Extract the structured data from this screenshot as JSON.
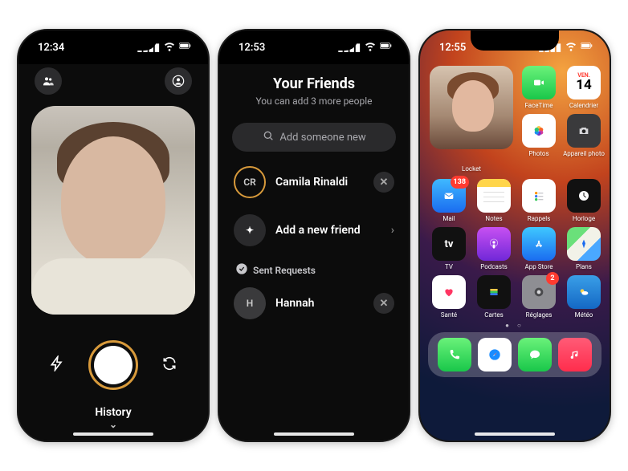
{
  "statusbar": {
    "time1": "12:34",
    "time2": "12:53",
    "time3": "12:55"
  },
  "screen1": {
    "history_label": "History"
  },
  "screen2": {
    "title": "Your Friends",
    "subtitle": "You can add 3 more people",
    "search_placeholder": "Add someone new",
    "friends": [
      {
        "initials": "CR",
        "name": "Camila Rinaldi"
      }
    ],
    "add_friend_label": "Add a new friend",
    "sent_requests_label": "Sent Requests",
    "pending": [
      {
        "initials": "H",
        "name": "Hannah"
      }
    ]
  },
  "screen3": {
    "widget_label": "Locket",
    "cal_weekday": "VEN.",
    "cal_daynum": "14",
    "apps_row1": [
      {
        "label": "FaceTime"
      },
      {
        "label": "Calendrier"
      }
    ],
    "apps_row2": [
      {
        "label": "Photos"
      },
      {
        "label": "Appareil photo"
      }
    ],
    "apps_row3": [
      {
        "label": "Mail",
        "badge": "138"
      },
      {
        "label": "Notes"
      },
      {
        "label": "Rappels"
      },
      {
        "label": "Horloge"
      }
    ],
    "apps_row4": [
      {
        "label": "TV"
      },
      {
        "label": "Podcasts"
      },
      {
        "label": "App Store"
      },
      {
        "label": "Plans"
      }
    ],
    "apps_row5": [
      {
        "label": "Santé"
      },
      {
        "label": "Cartes"
      },
      {
        "label": "Réglages",
        "badge": "2"
      },
      {
        "label": "Météo"
      }
    ],
    "dock": [
      {
        "name": "phone"
      },
      {
        "name": "safari"
      },
      {
        "name": "messages"
      },
      {
        "name": "music"
      }
    ]
  }
}
